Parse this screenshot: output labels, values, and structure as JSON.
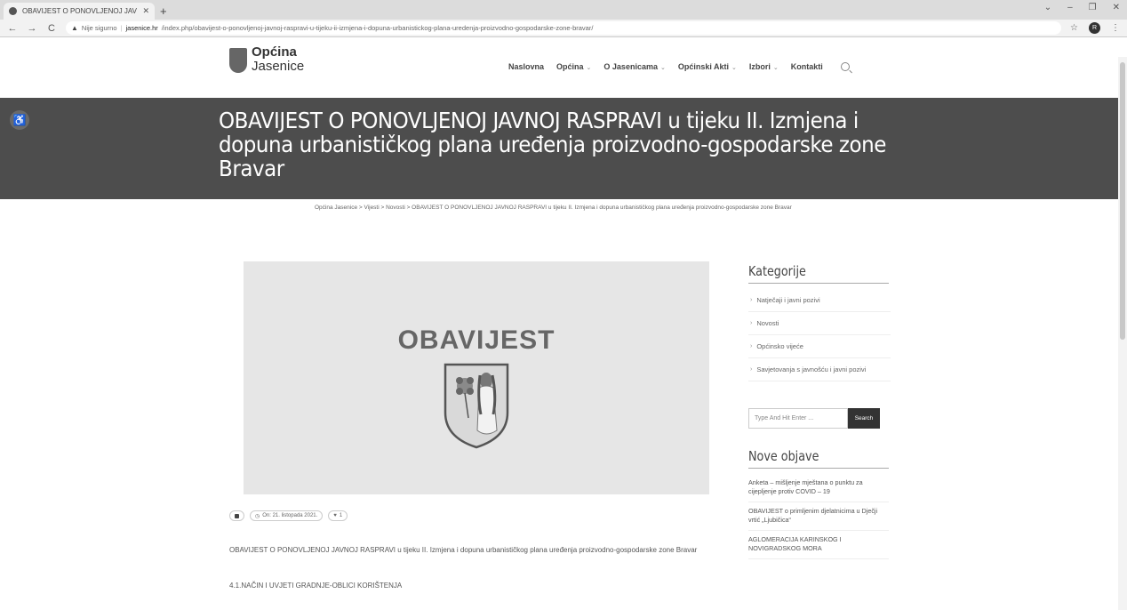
{
  "browser": {
    "tab_title": "OBAVIJEST O PONOVLJENOJ JAV",
    "tab_close": "✕",
    "new_tab": "+",
    "url_warning": "Nije sigurno",
    "url_domain": "jasenice.hr",
    "url_path": "/index.php/obavijest-o-ponovljenoj-javnoj-raspravi-u-tijeku-ii-izmjena-i-dopuna-urbanistickog-plana-uredenja-proizvodno-gospodarske-zone-bravar/",
    "profile_initial": "R"
  },
  "site": {
    "logo_line1": "Općina",
    "logo_line2": "Jasenice",
    "nav": [
      {
        "label": "Naslovna",
        "dropdown": false
      },
      {
        "label": "Općina",
        "dropdown": true
      },
      {
        "label": "O Jasenicama",
        "dropdown": true
      },
      {
        "label": "Općinski Akti",
        "dropdown": true
      },
      {
        "label": "Izbori",
        "dropdown": true
      },
      {
        "label": "Kontakti",
        "dropdown": false
      }
    ]
  },
  "banner": {
    "title": "OBAVIJEST O PONOVLJENOJ JAVNOJ RASPRAVI u tijeku II. Izmjena i dopuna urbanističkog plana uređenja proizvodno-gospodarske zone Bravar"
  },
  "breadcrumb": "Općina Jasenice > Vijesti > Novosti > OBAVIJEST O PONOVLJENOJ JAVNOJ RASPRAVI u tijeku II. Izmjena i dopuna urbanističkog plana uređenja proizvodno-gospodarske zone Bravar",
  "article": {
    "image_text": "OBAVIJEST",
    "date": "On: 21. listopada 2021.",
    "likes": "1",
    "paragraph": "OBAVIJEST O PONOVLJENOJ JAVNOJ RASPRAVI u tijeku II. Izmjena i dopuna urbanističkog plana uređenja proizvodno-gospodarske zone Bravar",
    "section": "4.1.NAČIN I UVJETI GRADNJE-OBLICI KORIŠTENJA"
  },
  "sidebar": {
    "categories_heading": "Kategorije",
    "categories": [
      "Natječaji i javni pozivi",
      "Novosti",
      "Općinsko vijeće",
      "Savjetovanja s javnošću i javni pozivi"
    ],
    "search_placeholder": "Type And Hit Enter ...",
    "search_button": "Search",
    "recent_heading": "Nove objave",
    "recent_posts": [
      "Anketa – mišljenje mještana o punktu za cijepljenje protiv COVID – 19",
      "OBAVIJEST o primljenim djelatnicima u Dječji vrtić „Ljubičica“",
      "AGLOMERACIJA KARINSKOG I NOVIGRADSKOG MORA"
    ]
  }
}
